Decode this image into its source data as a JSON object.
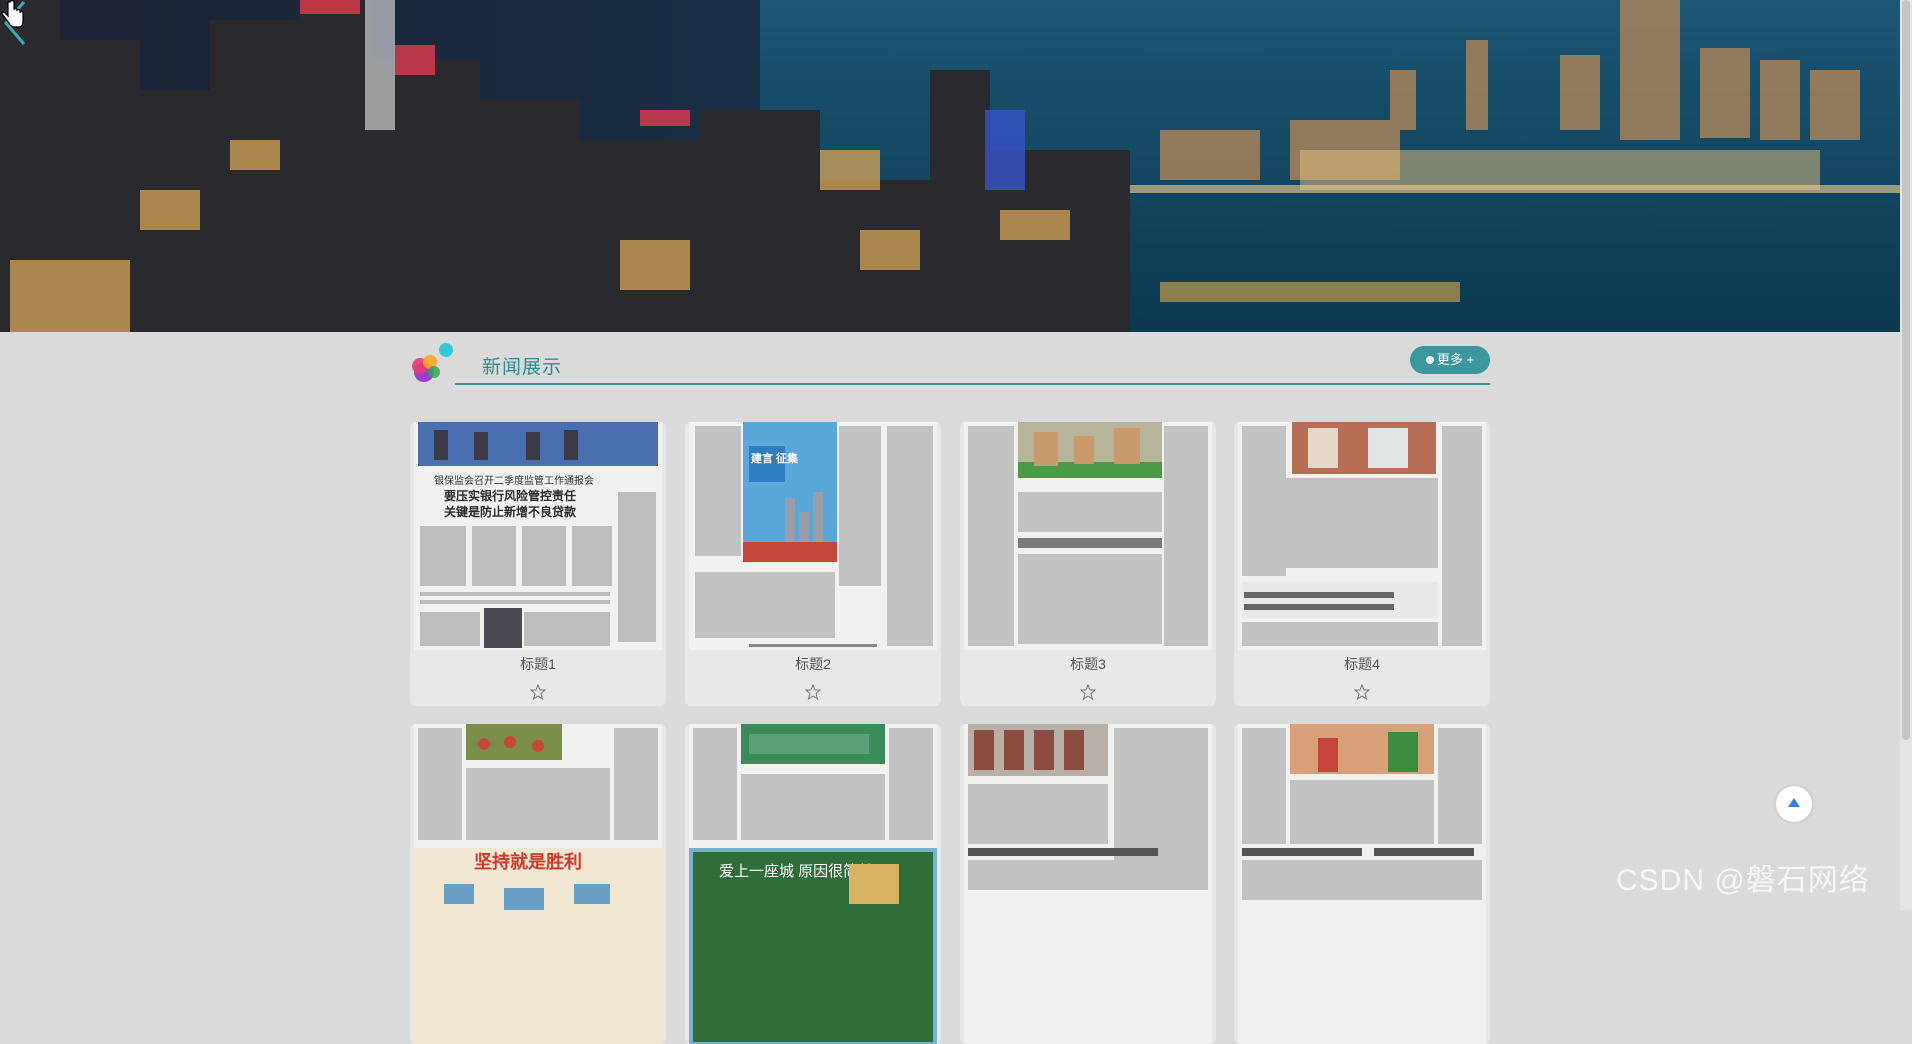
{
  "banner": {
    "prev_arrow_icon": "chevron-left-icon"
  },
  "section": {
    "title": "新闻展示",
    "more_label": "更多 +",
    "accent_color": "#3e979f"
  },
  "cards": [
    {
      "title": "标题1",
      "headline_a": "要压实银行风险管控责任",
      "headline_b": "关键是防止新增不良贷款"
    },
    {
      "title": "标题2",
      "tag": "建言 征集"
    },
    {
      "title": "标题3"
    },
    {
      "title": "标题4"
    },
    {
      "title": "",
      "headline": "坚持就是胜利"
    },
    {
      "title": "",
      "headline": "爱上一座城 原因很简单"
    },
    {
      "title": ""
    },
    {
      "title": ""
    }
  ],
  "back_to_top_icon": "arrow-up-icon",
  "watermark": "CSDN @磐石网络"
}
